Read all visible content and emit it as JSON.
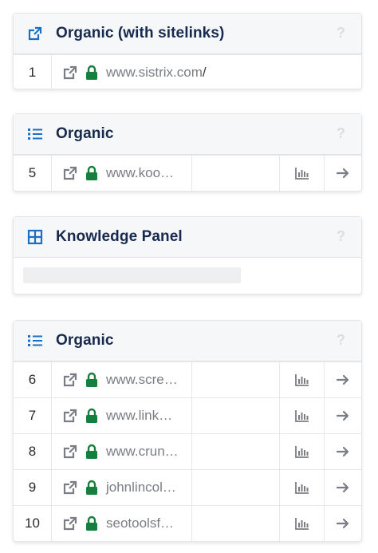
{
  "cards": [
    {
      "title": "Organic (with sitelinks)",
      "icon": "external-link-icon",
      "help": "?",
      "rows": [
        {
          "rank": "1",
          "domain": "www.sistrix.com",
          "suffix": "/"
        }
      ]
    },
    {
      "title": "Organic",
      "icon": "list-icon",
      "help": "?",
      "rows": [
        {
          "rank": "5",
          "domain": "www.koo…"
        }
      ]
    },
    {
      "title": "Knowledge Panel",
      "icon": "grid-icon",
      "help": "?"
    },
    {
      "title": "Organic",
      "icon": "list-icon",
      "help": "?",
      "rows": [
        {
          "rank": "6",
          "domain": "www.scre…"
        },
        {
          "rank": "7",
          "domain": "www.link…"
        },
        {
          "rank": "8",
          "domain": "www.crun…"
        },
        {
          "rank": "9",
          "domain": "johnlincol…"
        },
        {
          "rank": "10",
          "domain": "seotoolsf…"
        }
      ]
    }
  ],
  "icons": {
    "header_blue": "#1d6fc4",
    "lock_green": "#15803d",
    "icon_gray": "#7a7d83"
  }
}
